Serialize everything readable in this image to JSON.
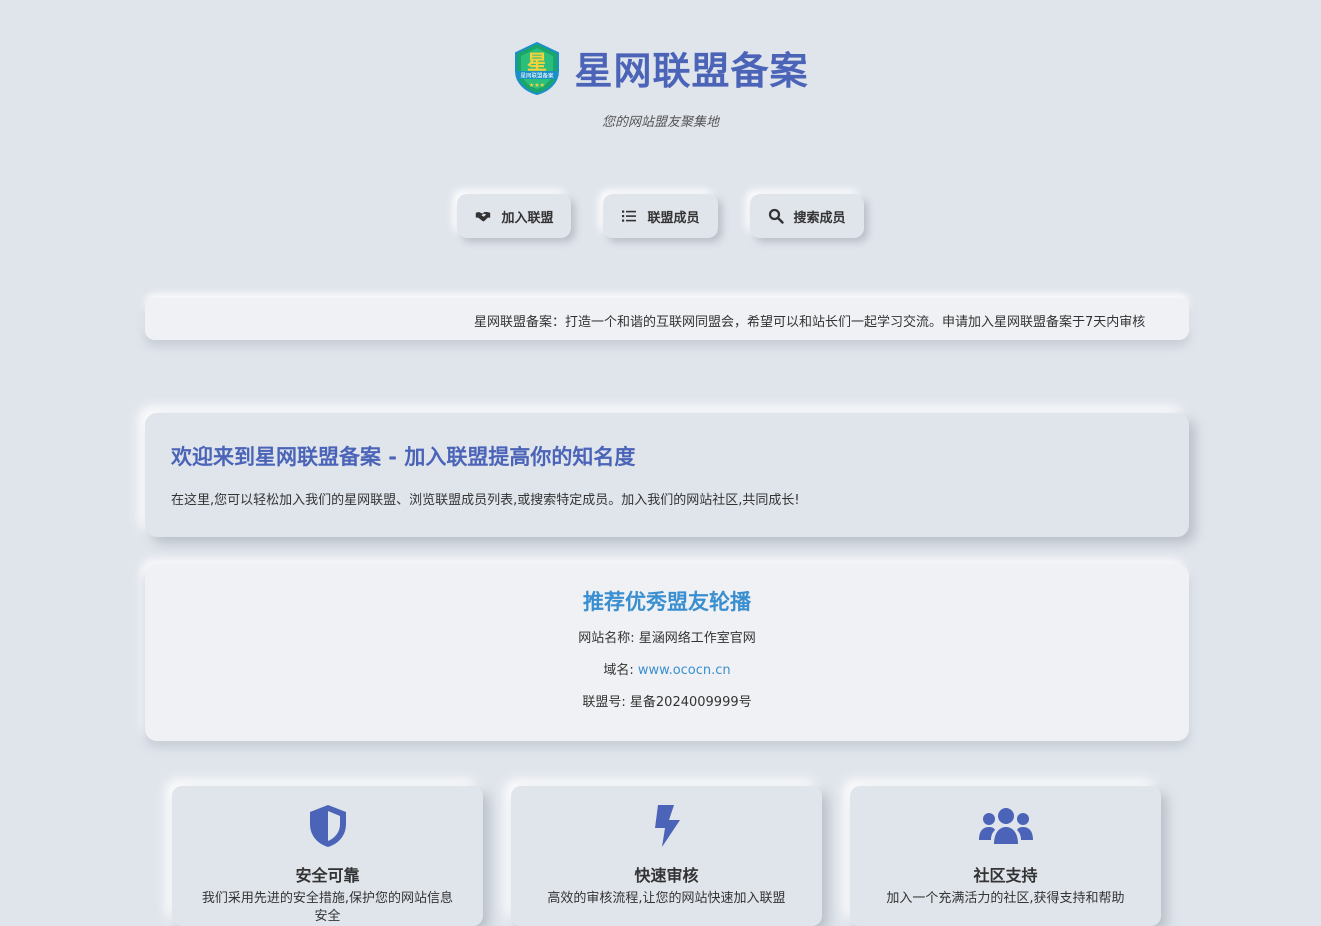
{
  "header": {
    "logo_text": "星",
    "logo_subtext": "星网联盟备案",
    "title": "星网联盟备案",
    "tagline": "您的网站盟友聚集地"
  },
  "nav": [
    {
      "label": "加入联盟",
      "icon": "handshake-icon"
    },
    {
      "label": "联盟成员",
      "icon": "list-icon"
    },
    {
      "label": "搜索成员",
      "icon": "search-icon"
    }
  ],
  "announcement": {
    "text": "星网联盟备案：打造一个和谐的互联网同盟会，希望可以和站长们一起学习交流。申请加入星网联盟备案于7天内审核"
  },
  "welcome": {
    "title": "欢迎来到星网联盟备案 - 加入联盟提高你的知名度",
    "description": "在这里,您可以轻松加入我们的星网联盟、浏览联盟成员列表,或搜索特定成员。加入我们的网站社区,共同成长!"
  },
  "carousel": {
    "title": "推荐优秀盟友轮播",
    "site_name_label": "网站名称:",
    "site_name": "星涵网络工作室官网",
    "domain_label": "域名:",
    "domain": "www.ococn.cn",
    "alliance_no_label": "联盟号:",
    "alliance_no": "星备2024009999号"
  },
  "features": [
    {
      "icon": "shield-icon",
      "title": "安全可靠",
      "desc": "我们采用先进的安全措施,保护您的网站信息安全"
    },
    {
      "icon": "lightning-icon",
      "title": "快速审核",
      "desc": "高效的审核流程,让您的网站快速加入联盟"
    },
    {
      "icon": "users-icon",
      "title": "社区支持",
      "desc": "加入一个充满活力的社区,获得支持和帮助"
    }
  ],
  "colors": {
    "background": "#e0e5ec",
    "brand": "#4b64b8",
    "accent": "#3a8fd0"
  }
}
